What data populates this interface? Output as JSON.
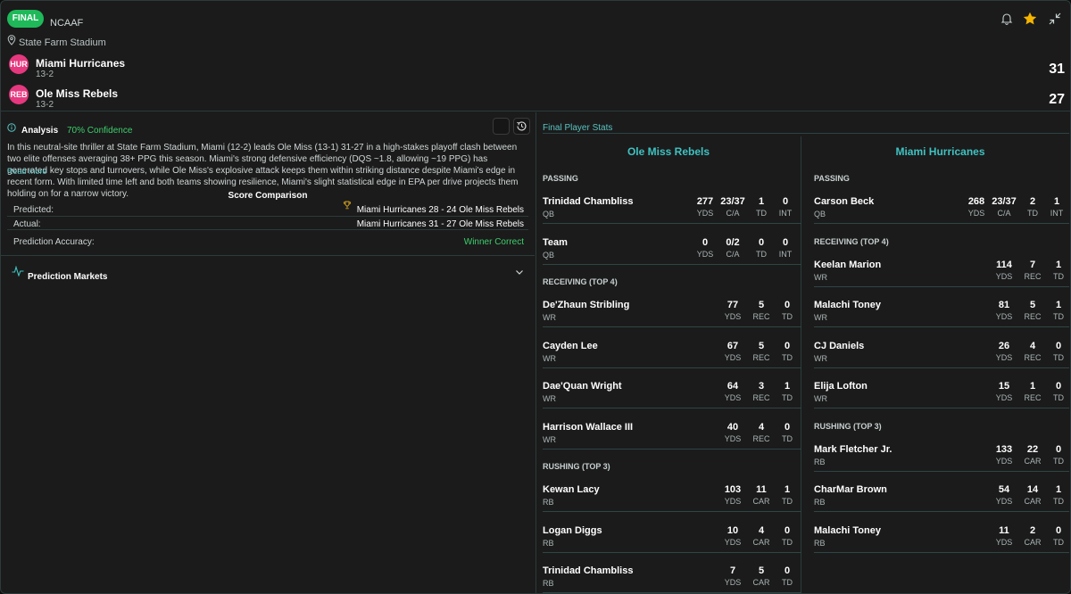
{
  "header": {
    "status": "FINAL",
    "league": "NCAAF",
    "venue": "State Farm Stadium",
    "teams": [
      {
        "abbr": "HUR",
        "name": "Miami Hurricanes",
        "record": "13-2",
        "score": "31"
      },
      {
        "abbr": "REB",
        "name": "Ole Miss Rebels",
        "record": "13-2",
        "score": "27"
      }
    ],
    "icons": [
      "bell-icon",
      "star-icon",
      "collapse-icon"
    ],
    "accent_color": "#1fb95a",
    "star_color": "#f5b400"
  },
  "analysis": {
    "title": "Analysis",
    "confidence": "70% Confidence",
    "text": "In this neutral-site thriller at State Farm Stadium, Miami (12-2) leads Ole Miss (13-1) 31-27 in a high-stakes playoff clash between two elite offenses averaging 38+ PPG this season. Miami's strong defensive efficiency (DQS ~1.8, allowing ~19 PPG) has generated key stops and turnovers, while Ole Miss's explosive attack keeps them within striking distance despite Miami's edge in recent form. With limited time left and both teams showing resilience, Miami's slight statistical edge in EPA per drive projects them holding on for a narrow victory.",
    "read_more": "Read more",
    "score_comparison": {
      "title": "Score Comparison",
      "predicted_label": "Predicted:",
      "predicted_value": "Miami Hurricanes 28 - 24 Ole Miss Rebels",
      "actual_label": "Actual:",
      "actual_value": "Miami Hurricanes 31 - 27 Ole Miss Rebels"
    },
    "accuracy_label": "Prediction Accuracy:",
    "accuracy_value": "Winner Correct",
    "prediction_markets": "Prediction Markets"
  },
  "player_stats": {
    "title": "Final Player Stats",
    "teams": [
      {
        "name": "Ole Miss Rebels",
        "sections": [
          {
            "title": "PASSING",
            "players": [
              {
                "name": "Trinidad Chambliss",
                "pos": "QB",
                "stats": [
                  {
                    "v": "277",
                    "l": "YDS"
                  },
                  {
                    "v": "23/37",
                    "l": "C/A"
                  },
                  {
                    "v": "1",
                    "l": "TD"
                  },
                  {
                    "v": "0",
                    "l": "INT"
                  }
                ]
              },
              {
                "name": "Team",
                "pos": "QB",
                "stats": [
                  {
                    "v": "0",
                    "l": "YDS"
                  },
                  {
                    "v": "0/2",
                    "l": "C/A"
                  },
                  {
                    "v": "0",
                    "l": "TD"
                  },
                  {
                    "v": "0",
                    "l": "INT"
                  }
                ]
              }
            ]
          },
          {
            "title": "RECEIVING (TOP 4)",
            "players": [
              {
                "name": "De'Zhaun Stribling",
                "pos": "WR",
                "stats": [
                  {
                    "v": "77",
                    "l": "YDS"
                  },
                  {
                    "v": "5",
                    "l": "REC"
                  },
                  {
                    "v": "0",
                    "l": "TD"
                  }
                ]
              },
              {
                "name": "Cayden Lee",
                "pos": "WR",
                "stats": [
                  {
                    "v": "67",
                    "l": "YDS"
                  },
                  {
                    "v": "5",
                    "l": "REC"
                  },
                  {
                    "v": "0",
                    "l": "TD"
                  }
                ]
              },
              {
                "name": "Dae'Quan Wright",
                "pos": "WR",
                "stats": [
                  {
                    "v": "64",
                    "l": "YDS"
                  },
                  {
                    "v": "3",
                    "l": "REC"
                  },
                  {
                    "v": "1",
                    "l": "TD"
                  }
                ]
              },
              {
                "name": "Harrison Wallace III",
                "pos": "WR",
                "stats": [
                  {
                    "v": "40",
                    "l": "YDS"
                  },
                  {
                    "v": "4",
                    "l": "REC"
                  },
                  {
                    "v": "0",
                    "l": "TD"
                  }
                ]
              }
            ]
          },
          {
            "title": "RUSHING (TOP 3)",
            "players": [
              {
                "name": "Kewan Lacy",
                "pos": "RB",
                "stats": [
                  {
                    "v": "103",
                    "l": "YDS"
                  },
                  {
                    "v": "11",
                    "l": "CAR"
                  },
                  {
                    "v": "1",
                    "l": "TD"
                  }
                ]
              },
              {
                "name": "Logan Diggs",
                "pos": "RB",
                "stats": [
                  {
                    "v": "10",
                    "l": "YDS"
                  },
                  {
                    "v": "4",
                    "l": "CAR"
                  },
                  {
                    "v": "0",
                    "l": "TD"
                  }
                ]
              },
              {
                "name": "Trinidad Chambliss",
                "pos": "RB",
                "stats": [
                  {
                    "v": "7",
                    "l": "YDS"
                  },
                  {
                    "v": "5",
                    "l": "CAR"
                  },
                  {
                    "v": "0",
                    "l": "TD"
                  }
                ]
              }
            ]
          }
        ]
      },
      {
        "name": "Miami Hurricanes",
        "sections": [
          {
            "title": "PASSING",
            "players": [
              {
                "name": "Carson Beck",
                "pos": "QB",
                "stats": [
                  {
                    "v": "268",
                    "l": "YDS"
                  },
                  {
                    "v": "23/37",
                    "l": "C/A"
                  },
                  {
                    "v": "2",
                    "l": "TD"
                  },
                  {
                    "v": "1",
                    "l": "INT"
                  }
                ]
              }
            ]
          },
          {
            "title": "RECEIVING (TOP 4)",
            "players": [
              {
                "name": "Keelan Marion",
                "pos": "WR",
                "stats": [
                  {
                    "v": "114",
                    "l": "YDS"
                  },
                  {
                    "v": "7",
                    "l": "REC"
                  },
                  {
                    "v": "1",
                    "l": "TD"
                  }
                ]
              },
              {
                "name": "Malachi Toney",
                "pos": "WR",
                "stats": [
                  {
                    "v": "81",
                    "l": "YDS"
                  },
                  {
                    "v": "5",
                    "l": "REC"
                  },
                  {
                    "v": "1",
                    "l": "TD"
                  }
                ]
              },
              {
                "name": "CJ Daniels",
                "pos": "WR",
                "stats": [
                  {
                    "v": "26",
                    "l": "YDS"
                  },
                  {
                    "v": "4",
                    "l": "REC"
                  },
                  {
                    "v": "0",
                    "l": "TD"
                  }
                ]
              },
              {
                "name": "Elija Lofton",
                "pos": "WR",
                "stats": [
                  {
                    "v": "15",
                    "l": "YDS"
                  },
                  {
                    "v": "1",
                    "l": "REC"
                  },
                  {
                    "v": "0",
                    "l": "TD"
                  }
                ]
              }
            ]
          },
          {
            "title": "RUSHING (TOP 3)",
            "players": [
              {
                "name": "Mark Fletcher Jr.",
                "pos": "RB",
                "stats": [
                  {
                    "v": "133",
                    "l": "YDS"
                  },
                  {
                    "v": "22",
                    "l": "CAR"
                  },
                  {
                    "v": "0",
                    "l": "TD"
                  }
                ]
              },
              {
                "name": "CharMar Brown",
                "pos": "RB",
                "stats": [
                  {
                    "v": "54",
                    "l": "YDS"
                  },
                  {
                    "v": "14",
                    "l": "CAR"
                  },
                  {
                    "v": "1",
                    "l": "TD"
                  }
                ]
              },
              {
                "name": "Malachi Toney",
                "pos": "RB",
                "stats": [
                  {
                    "v": "11",
                    "l": "YDS"
                  },
                  {
                    "v": "2",
                    "l": "CAR"
                  },
                  {
                    "v": "0",
                    "l": "TD"
                  }
                ]
              }
            ]
          }
        ]
      }
    ]
  }
}
